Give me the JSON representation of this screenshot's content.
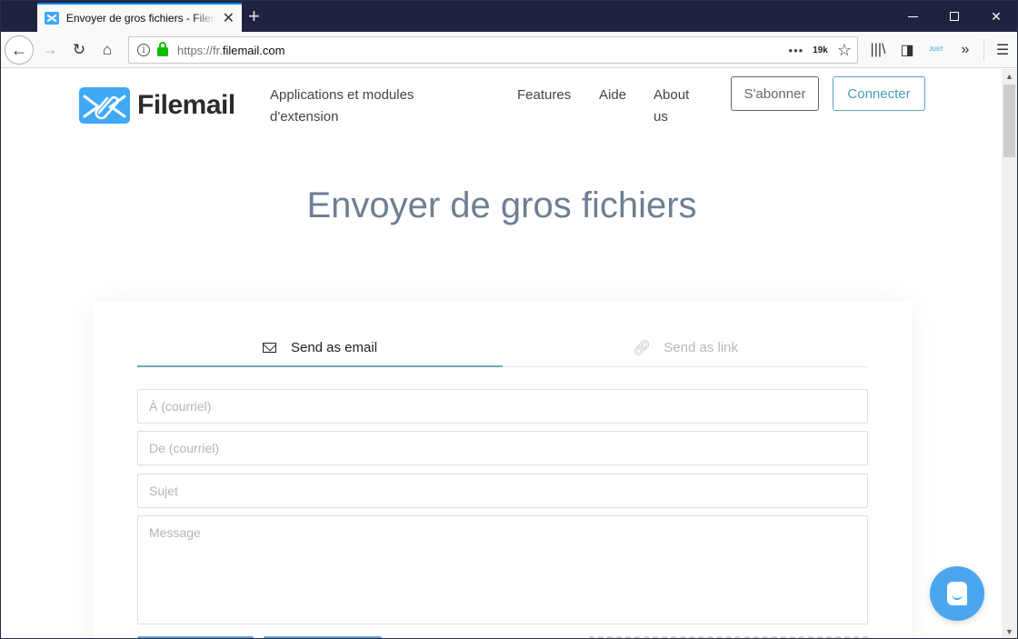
{
  "browser": {
    "tab_title": "Envoyer de gros fichiers - Filemail",
    "new_tab_label": "+",
    "url_prefix": "https://fr.",
    "url_domain": "filemail.com",
    "page_actions_label": "•••",
    "extension_badge": "19k",
    "extension_just_label": "JUST"
  },
  "header": {
    "logo_text": "Filemail",
    "nav": [
      {
        "label_line1": "Applications et modules",
        "label_line2": "d'extension"
      },
      {
        "label": "Features"
      },
      {
        "label": "Aide"
      },
      {
        "label_line1": "About",
        "label_line2": "us"
      }
    ],
    "subscribe_label": "S'abonner",
    "login_label": "Connecter"
  },
  "hero": {
    "title": "Envoyer de gros fichiers"
  },
  "form": {
    "tabs": [
      {
        "label": "Send as email",
        "icon": "envelope-icon",
        "active": true
      },
      {
        "label": "Send as link",
        "icon": "link-icon",
        "active": false
      }
    ],
    "to_placeholder": "À (courriel)",
    "from_placeholder": "De (courriel)",
    "subject_placeholder": "Sujet",
    "message_placeholder": "Message"
  },
  "colors": {
    "brand": "#3fa9f5",
    "accent_tab_underline": "#6fa7bb",
    "title": "#6e7f93",
    "chat_bubble": "#4ba6f0"
  }
}
